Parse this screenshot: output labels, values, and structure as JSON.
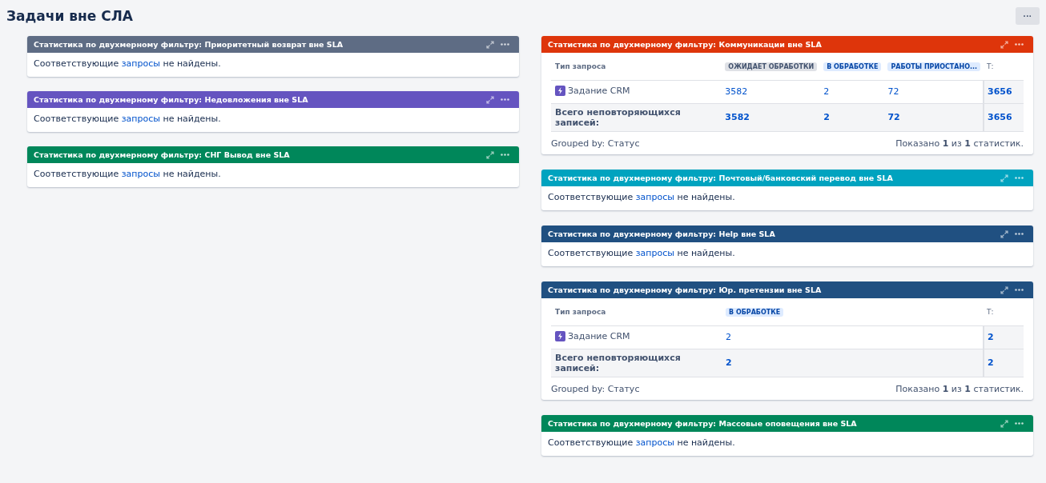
{
  "page": {
    "title": "Задачи вне СЛА",
    "menu_button": "···"
  },
  "columns": [
    {
      "gadgets": [
        {
          "title": "Статистика по двухмерному фильтру: Приоритетный возврат вне SLA",
          "color": "#5e6c84",
          "kind": "empty",
          "message": {
            "before": "Соответствующие",
            "link": "запросы",
            "after": "не найдены."
          }
        },
        {
          "title": "Статистика по двухмерному фильтру: Недовложения вне SLA",
          "color": "#6554c0",
          "kind": "empty",
          "message": {
            "before": "Соответствующие",
            "link": "запросы",
            "after": "не найдены."
          }
        },
        {
          "title": "Статистика по двухмерному фильтру: СНГ Вывод вне SLA",
          "color": "#00875a",
          "kind": "empty",
          "message": {
            "before": "Соответствующие",
            "link": "запросы",
            "after": "не найдены."
          }
        }
      ]
    },
    {
      "gadgets": [
        {
          "title": "Статистика по двухмерному фильтру: Коммуникации вне SLA",
          "color": "#de350b",
          "kind": "table",
          "table": {
            "first_header": "Тип запроса",
            "total_header": "Т:",
            "statuses": [
              {
                "label": "ОЖИДАЕТ ОБРАБОТКИ",
                "kind": "new"
              },
              {
                "label": "В ОБРАБОТКЕ",
                "kind": "progress"
              },
              {
                "label": "РАБОТЫ ПРИОСТАНО...",
                "kind": "progress"
              }
            ],
            "rows": [
              {
                "type": "Задание CRM",
                "values": [
                  "3582",
                  "2",
                  "72"
                ],
                "total": "3656"
              }
            ],
            "totals": {
              "label": "Всего неповторяющихся записей:",
              "values": [
                "3582",
                "2",
                "72"
              ],
              "total": "3656"
            },
            "grouped_by": "Grouped by: Статус",
            "shown": "Показано **1** из **1** статистик."
          }
        },
        {
          "title": "Статистика по двухмерному фильтру: Почтовый/банковский перевод вне SLA",
          "color": "#00a3bf",
          "kind": "empty",
          "message": {
            "before": "Соответствующие",
            "link": "запросы",
            "after": "не найдены."
          }
        },
        {
          "title": "Статистика по двухмерному фильтру: Help вне SLA",
          "color": "#205081",
          "kind": "empty",
          "message": {
            "before": "Соответствующие",
            "link": "запросы",
            "after": "не найдены."
          }
        },
        {
          "title": "Статистика по двухмерному фильтру: Юр. претензии вне SLA",
          "color": "#205081",
          "kind": "table",
          "table": {
            "first_header": "Тип запроса",
            "total_header": "Т:",
            "statuses": [
              {
                "label": "В ОБРАБОТКЕ",
                "kind": "progress"
              }
            ],
            "rows": [
              {
                "type": "Задание CRM",
                "values": [
                  "2"
                ],
                "total": "2"
              }
            ],
            "totals": {
              "label": "Всего неповторяющихся записей:",
              "values": [
                "2"
              ],
              "total": "2"
            },
            "grouped_by": "Grouped by: Статус",
            "shown": "Показано **1** из **1** статистик."
          }
        },
        {
          "title": "Статистика по двухмерному фильтру: Массовые оповещения вне SLA",
          "color": "#00875a",
          "kind": "empty",
          "message": {
            "before": "Соответствующие",
            "link": "запросы",
            "after": "не найдены."
          }
        }
      ]
    }
  ]
}
